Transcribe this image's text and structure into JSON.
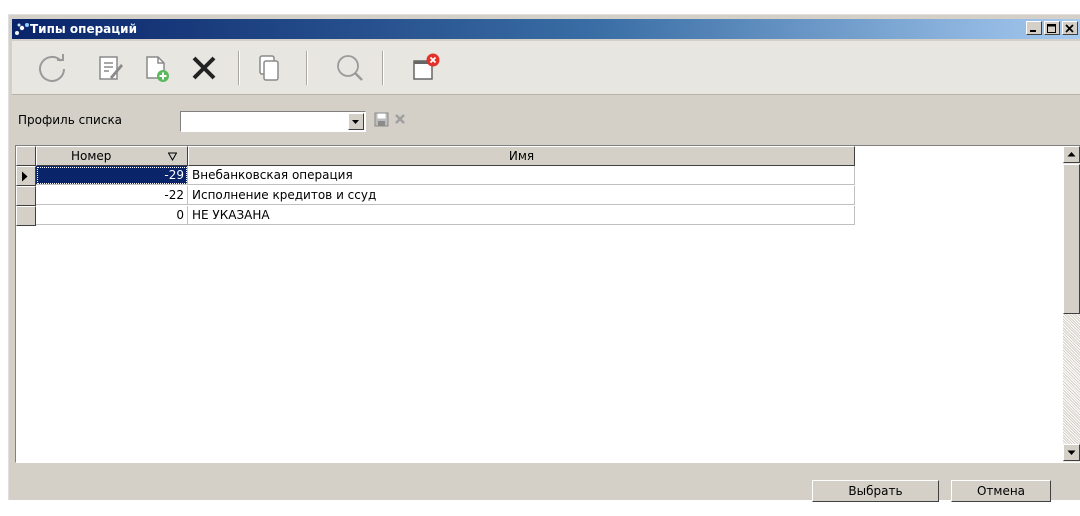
{
  "window": {
    "title": "Типы операций"
  },
  "toolbar": {
    "icons": [
      "refresh-icon",
      "edit-icon",
      "new-document-icon",
      "delete-icon",
      "copy-icon",
      "search-icon",
      "close-window-icon"
    ]
  },
  "filter": {
    "profile_label": "Профиль списка",
    "profile_value": ""
  },
  "table": {
    "columns": [
      "Номер",
      "Имя"
    ],
    "rows": [
      {
        "number": "-29",
        "name": "Внебанковская операция"
      },
      {
        "number": "-22",
        "name": "Исполнение кредитов и ссуд"
      },
      {
        "number": "0",
        "name": "НЕ УКАЗАНА"
      }
    ]
  },
  "footer": {
    "select_label": "Выбрать",
    "cancel_label": "Отмена"
  },
  "colors": {
    "title_gradient_start": "#0a246a",
    "selection": "#0a246a",
    "face": "#d4d0c8"
  }
}
